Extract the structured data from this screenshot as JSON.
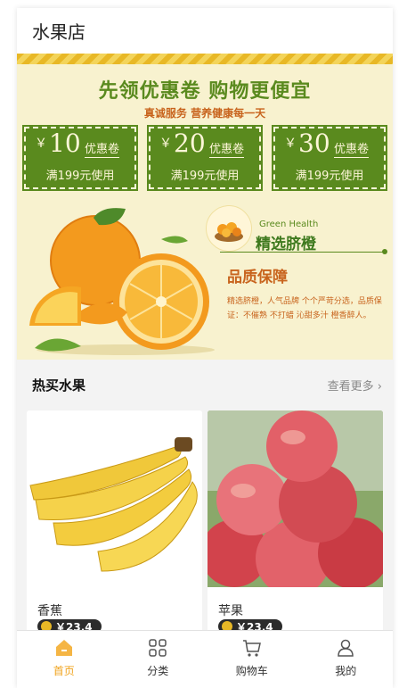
{
  "header": {
    "title": "水果店"
  },
  "banner": {
    "headline": "先领优惠卷 购物更便宜",
    "subline": "真诚服务 营养健康每一天",
    "coupons": [
      {
        "currency": "￥",
        "amount": "10",
        "label": "优惠卷",
        "condition": "满199元使用"
      },
      {
        "currency": "￥",
        "amount": "20",
        "label": "优惠卷",
        "condition": "满199元使用"
      },
      {
        "currency": "￥",
        "amount": "30",
        "label": "优惠卷",
        "condition": "满199元使用"
      }
    ],
    "green_health_en": "Green Health",
    "green_health_title": "精选脐橙",
    "quality_title": "品质保障",
    "quality_desc": "精选脐橙，人气品牌 个个严苛分选，品质保证：不催熟 不打蜡 沁甜多汁 橙香醉人。"
  },
  "section": {
    "title": "热买水果",
    "more": "查看更多"
  },
  "products": [
    {
      "name": "香蕉",
      "price": "￥23.4"
    },
    {
      "name": "苹果",
      "price": "￥23.4"
    }
  ],
  "tabbar": {
    "items": [
      {
        "label": "首页",
        "icon": "home-icon",
        "active": true
      },
      {
        "label": "分类",
        "icon": "grid-icon",
        "active": false
      },
      {
        "label": "购物车",
        "icon": "cart-icon",
        "active": false
      },
      {
        "label": "我的",
        "icon": "user-icon",
        "active": false
      }
    ]
  },
  "colors": {
    "accent": "#f0a31c",
    "banner_green": "#5a8a1e",
    "banner_orange": "#c8641d"
  }
}
